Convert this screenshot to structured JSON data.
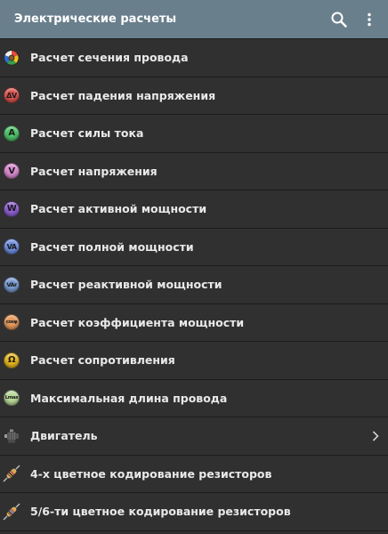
{
  "appbar": {
    "title": "Электрические расчеты",
    "search_icon": "search-icon",
    "menu_icon": "more-vert-icon",
    "background": "#6a7f8c"
  },
  "items": [
    {
      "label": "Расчет сечения провода",
      "icon": "wire-section-icon",
      "color": "multi"
    },
    {
      "label": "Расчет падения напряжения",
      "icon": "delta-v-icon",
      "glyph": "ΔV",
      "color": "#d9534f"
    },
    {
      "label": "Расчет силы тока",
      "icon": "ampere-icon",
      "glyph": "A",
      "color": "#4fc36a"
    },
    {
      "label": "Расчет напряжения",
      "icon": "volt-icon",
      "glyph": "V",
      "color": "#d98ad0"
    },
    {
      "label": "Расчет активной мощности",
      "icon": "watt-icon",
      "glyph": "W",
      "color": "#8f5fd1"
    },
    {
      "label": "Расчет полной мощности",
      "icon": "va-icon",
      "glyph": "VA",
      "color": "#6f8fe0"
    },
    {
      "label": "Расчет реактивной мощности",
      "icon": "var-icon",
      "glyph": "VAr",
      "color": "#7a9ad0"
    },
    {
      "label": "Расчет коэффициента мощности",
      "icon": "cos-phi-icon",
      "glyph": "cosφ",
      "color": "#e59a5e"
    },
    {
      "label": "Расчет сопротивления",
      "icon": "ohm-icon",
      "glyph": "Ω",
      "color": "#e8b820"
    },
    {
      "label": "Максимальная длина провода",
      "icon": "length-max-icon",
      "glyph": "Lmax",
      "color": "#b9d99a"
    },
    {
      "label": "Двигатель",
      "icon": "motor-icon",
      "has_submenu": true,
      "chevron_icon": "chevron-right-icon"
    },
    {
      "label": "4-х цветное кодирование резисторов",
      "icon": "resistor-icon"
    },
    {
      "label": "5/6-ти цветное кодирование резисторов",
      "icon": "resistor-icon"
    }
  ]
}
